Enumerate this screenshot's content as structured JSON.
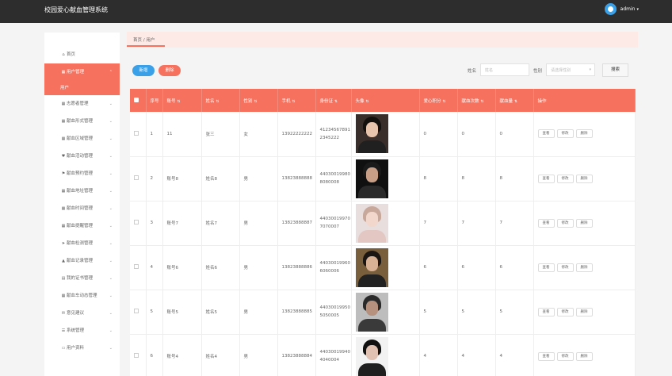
{
  "header": {
    "title": "校园爱心献血管理系统",
    "username": "admin",
    "caret": "▾"
  },
  "sidebar": {
    "items": [
      {
        "name": "home",
        "icon": "⌂",
        "icon_name": "home-icon",
        "label": "首页",
        "chevron": ""
      },
      {
        "name": "user-management",
        "icon": "▦",
        "icon_name": "grid-icon",
        "label": "用户管理",
        "chevron": "⌃",
        "active": true
      },
      {
        "name": "volunteer-management",
        "icon": "▦",
        "icon_name": "grid-icon",
        "label": "志愿者管理",
        "chevron": "⌄"
      },
      {
        "name": "blood-type-management",
        "icon": "▦",
        "icon_name": "grid-icon",
        "label": "献血形式管理",
        "chevron": "⌄"
      },
      {
        "name": "blood-area-management",
        "icon": "▦",
        "icon_name": "grid-icon",
        "label": "献血区域管理",
        "chevron": "⌄"
      },
      {
        "name": "blood-activity-management",
        "icon": "♥",
        "icon_name": "heart-icon",
        "label": "献血活动管理",
        "chevron": "⌄"
      },
      {
        "name": "blood-appointment-management",
        "icon": "⚑",
        "icon_name": "flag-icon",
        "label": "献血预约管理",
        "chevron": "⌄"
      },
      {
        "name": "blood-location-management",
        "icon": "▦",
        "icon_name": "grid-icon",
        "label": "献血地址管理",
        "chevron": "⌄"
      },
      {
        "name": "blood-time-management",
        "icon": "▦",
        "icon_name": "grid-icon",
        "label": "献血时间管理",
        "chevron": "⌄"
      },
      {
        "name": "blood-reminder-management",
        "icon": "▦",
        "icon_name": "grid-icon",
        "label": "献血提醒管理",
        "chevron": "⌄"
      },
      {
        "name": "blood-test-management",
        "icon": "➤",
        "icon_name": "send-icon",
        "label": "献血检测管理",
        "chevron": "⌄"
      },
      {
        "name": "blood-record-management",
        "icon": "▲",
        "icon_name": "chart-icon",
        "label": "献血记录管理",
        "chevron": "⌄"
      },
      {
        "name": "my-certificate-management",
        "icon": "▤",
        "icon_name": "document-icon",
        "label": "我的证书管理",
        "chevron": "⌄"
      },
      {
        "name": "blood-vehicle-management",
        "icon": "▦",
        "icon_name": "grid-icon",
        "label": "献血车动态管理",
        "chevron": "⌄"
      },
      {
        "name": "feedback",
        "icon": "✉",
        "icon_name": "message-icon",
        "label": "意见建议",
        "chevron": "⌄"
      },
      {
        "name": "system-management",
        "icon": "☰",
        "icon_name": "list-icon",
        "label": "系统管理",
        "chevron": "⌄"
      },
      {
        "name": "user-profile",
        "icon": "▭",
        "icon_name": "profile-icon",
        "label": "用户资料",
        "chevron": "⌄"
      }
    ],
    "sub_item": "用户"
  },
  "breadcrumb": {
    "text": "首页 / 用户"
  },
  "toolbar": {
    "add_label": "新增",
    "delete_label": "删除"
  },
  "filters": {
    "name_label": "姓名",
    "name_placeholder": "姓名",
    "gender_label": "性别",
    "gender_placeholder": "请选择性别",
    "search_label": "搜索"
  },
  "table": {
    "headers": {
      "index": "序号",
      "account": "账号",
      "name": "姓名",
      "gender": "性别",
      "phone": "手机",
      "idcard": "身份证",
      "photo": "头像",
      "points": "爱心积分",
      "donations": "献血次数",
      "volume": "献血量",
      "actions": "操作"
    },
    "action_labels": {
      "view": "查看",
      "edit": "修改",
      "delete": "删除"
    },
    "rows": [
      {
        "index": "1",
        "account": "11",
        "name": "张三",
        "gender": "女",
        "phone": "13922222222",
        "idcard_1": "41234567891",
        "idcard_2": "2345222",
        "points": "0",
        "donations": "0",
        "volume": "0",
        "photo": {
          "bg": "#3a2e2a",
          "hair": "#14100e",
          "face": "#e8c4ad",
          "body": "#202020"
        }
      },
      {
        "index": "2",
        "account": "账号8",
        "name": "姓名8",
        "gender": "男",
        "phone": "13823888888",
        "idcard_1": "44030019980",
        "idcard_2": "8080008",
        "points": "8",
        "donations": "8",
        "volume": "8",
        "photo": {
          "bg": "#101010",
          "hair": "#1a1a1a",
          "face": "#c89f86",
          "body": "#2a2a2a"
        }
      },
      {
        "index": "3",
        "account": "账号7",
        "name": "姓名7",
        "gender": "男",
        "phone": "13823888887",
        "idcard_1": "44030019970",
        "idcard_2": "7070007",
        "points": "7",
        "donations": "7",
        "volume": "7",
        "photo": {
          "bg": "#e9dede",
          "hair": "#c7a89b",
          "face": "#f2d7cc",
          "body": "#e2c7c2"
        }
      },
      {
        "index": "4",
        "account": "账号6",
        "name": "姓名6",
        "gender": "男",
        "phone": "13823888886",
        "idcard_1": "44030019960",
        "idcard_2": "6060006",
        "points": "6",
        "donations": "6",
        "volume": "6",
        "photo": {
          "bg": "#7a5f3c",
          "hair": "#1c1612",
          "face": "#d9b194",
          "body": "#222222"
        }
      },
      {
        "index": "5",
        "account": "账号5",
        "name": "姓名5",
        "gender": "男",
        "phone": "13823888885",
        "idcard_1": "44030019950",
        "idcard_2": "5050005",
        "points": "5",
        "donations": "5",
        "volume": "5",
        "photo": {
          "bg": "#bdbdbd",
          "hair": "#2a2a2a",
          "face": "#b5917e",
          "body": "#3a3a3a"
        }
      },
      {
        "index": "6",
        "account": "账号4",
        "name": "姓名4",
        "gender": "男",
        "phone": "13823888884",
        "idcard_1": "44030019940",
        "idcard_2": "4040004",
        "points": "4",
        "donations": "4",
        "volume": "4",
        "photo": {
          "bg": "#f2f2f2",
          "hair": "#111111",
          "face": "#e1c2b2",
          "body": "#1f1f1f"
        }
      }
    ]
  },
  "icons": {
    "sort": "⇅"
  },
  "colors": {
    "accent": "#f6725f",
    "blue": "#3aa0e8",
    "topbar": "#2d2d2d"
  }
}
